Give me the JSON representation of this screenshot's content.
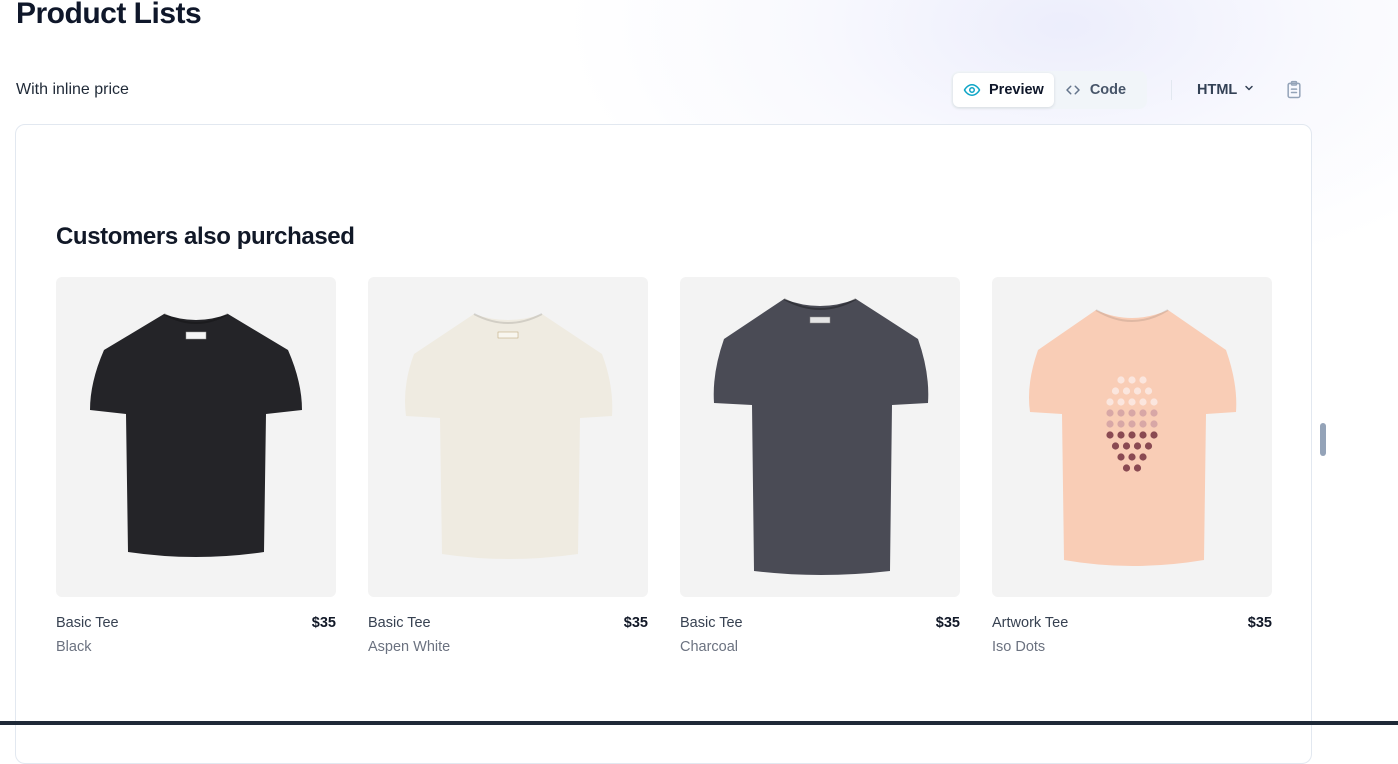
{
  "page": {
    "title": "Product Lists",
    "subtitle": "With inline price"
  },
  "toolbar": {
    "preview_label": "Preview",
    "code_label": "Code",
    "language": "HTML",
    "active_tab": "Preview"
  },
  "preview": {
    "heading": "Customers also purchased",
    "products": [
      {
        "name": "Basic Tee",
        "price": "$35",
        "color": "Black",
        "shirt_color": "#242428",
        "image_icon": "tshirt-black"
      },
      {
        "name": "Basic Tee",
        "price": "$35",
        "color": "Aspen White",
        "shirt_color": "#efebe1",
        "image_icon": "tshirt-aspen-white"
      },
      {
        "name": "Basic Tee",
        "price": "$35",
        "color": "Charcoal",
        "shirt_color": "#4a4b55",
        "image_icon": "tshirt-charcoal"
      },
      {
        "name": "Artwork Tee",
        "price": "$35",
        "color": "Iso Dots",
        "shirt_color": "#f9cdb6",
        "image_icon": "tshirt-iso-dots"
      }
    ]
  },
  "colors": {
    "accent": "#0ea5c6",
    "text_primary": "#111827",
    "text_secondary": "#6b7280",
    "image_bg": "#f3f3f3"
  }
}
